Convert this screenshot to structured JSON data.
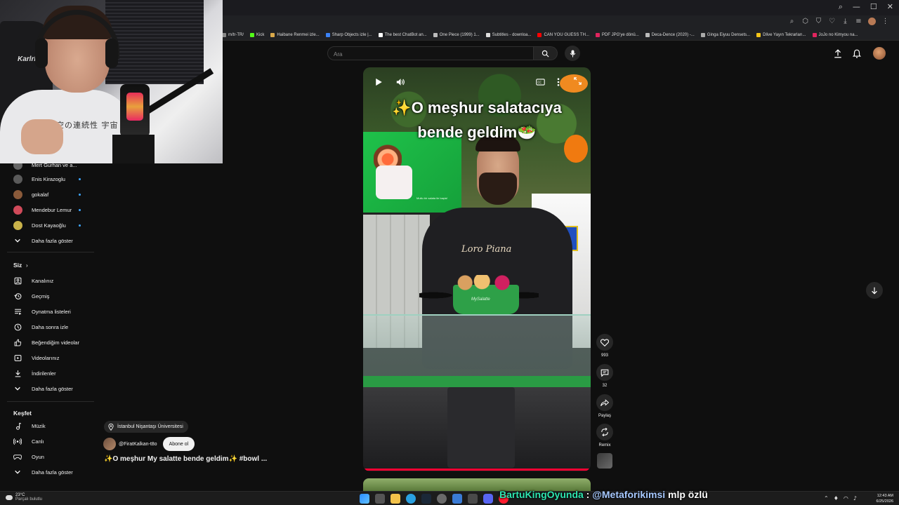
{
  "browser": {
    "window_controls": [
      "⌕",
      "—",
      "☐",
      "✕"
    ],
    "bookmarks": [
      {
        "label": "m/tr-TR/",
        "color": "#888888"
      },
      {
        "label": "Kick",
        "color": "#53fc18"
      },
      {
        "label": "Haibane Renmei izle...",
        "color": "#d9a84a"
      },
      {
        "label": "Sharp Objects izle |...",
        "color": "#3b82f6"
      },
      {
        "label": "The best ChatBot an...",
        "color": "#ffffff"
      },
      {
        "label": "One Piece (1999) 1...",
        "color": "#bbbbbb"
      },
      {
        "label": "Subtitles - downloa...",
        "color": "#dddddd"
      },
      {
        "label": "CAN YOU GUESS TH...",
        "color": "#ff0000"
      },
      {
        "label": "PDF JPG'ye dönü...",
        "color": "#e0245e"
      },
      {
        "label": "Deca-Dence (2020) -...",
        "color": "#bbbbbb"
      },
      {
        "label": "Ginga Eiyuu Densets...",
        "color": "#aaaaaa"
      },
      {
        "label": "Dlive Yayın Tekrarları...",
        "color": "#f5c518"
      },
      {
        "label": "JoJo no Kimyou na...",
        "color": "#e0245e"
      }
    ]
  },
  "header": {
    "search_placeholder": "Ara"
  },
  "sidebar": {
    "subscriptions": [
      {
        "label": "Mert Gurhan ve a...",
        "avatar_color": "#666666"
      },
      {
        "label": "Enis Kirazoglu",
        "avatar_color": "#5a5a5a"
      },
      {
        "label": "gokalaf",
        "avatar_color": "#8a5a3a"
      },
      {
        "label": "Mendebur Lemur",
        "avatar_color": "#d04a5a"
      },
      {
        "label": "Dost Kayaoğlu",
        "avatar_color": "#c9b24a"
      }
    ],
    "show_more_1": "Daha fazla göster",
    "you_heading": "Siz",
    "you_items": [
      {
        "label": "Kanalınız",
        "icon": "channel-icon"
      },
      {
        "label": "Geçmiş",
        "icon": "history-icon"
      },
      {
        "label": "Oynatma listeleri",
        "icon": "playlists-icon"
      },
      {
        "label": "Daha sonra izle",
        "icon": "watch-later-icon"
      },
      {
        "label": "Beğendiğim videolar",
        "icon": "thumbs-up-icon"
      },
      {
        "label": "Videolarınız",
        "icon": "your-videos-icon"
      },
      {
        "label": "İndirilenler",
        "icon": "download-icon"
      }
    ],
    "show_more_2": "Daha fazla göster",
    "explore_heading": "Keşfet",
    "explore_items": [
      {
        "label": "Müzik",
        "icon": "music-icon"
      },
      {
        "label": "Canlı",
        "icon": "live-icon"
      },
      {
        "label": "Oyun",
        "icon": "gaming-icon"
      }
    ],
    "show_more_3": "Daha fazla göster"
  },
  "webcam": {
    "chair_brand": "KarlrMe",
    "shirt_text": "時空の連続性 宇宙"
  },
  "video": {
    "caption_line1": "✨O meşhur salatacıya",
    "caption_line2": "bende geldim🥗",
    "shirt_logo": "Loro Piana",
    "bowl_label": "MySalatte",
    "poster_text": "Mutlu bir salata ile başla!",
    "progress": 1.0
  },
  "actions": {
    "like_count": "993",
    "comment_count": "32",
    "share_label": "Paylaş",
    "remix_label": "Remix"
  },
  "info": {
    "location": "İstanbul Nişantaşı Üniversitesi",
    "channel_name": "@FiratKalkan-t8o",
    "subscribe_label": "Abone ol",
    "title": "✨O meşhur My salatte bende geldim✨ #bowl ..."
  },
  "taskbar": {
    "temp": "23°C",
    "weather": "Parçalı bulutlu",
    "time": "12:43 AM",
    "date": "6/25/2026"
  },
  "chat": {
    "user": "BartuKingOyunda",
    "colon": ":",
    "mention": "@Metaforikimsi",
    "message": "mlp özlü"
  }
}
